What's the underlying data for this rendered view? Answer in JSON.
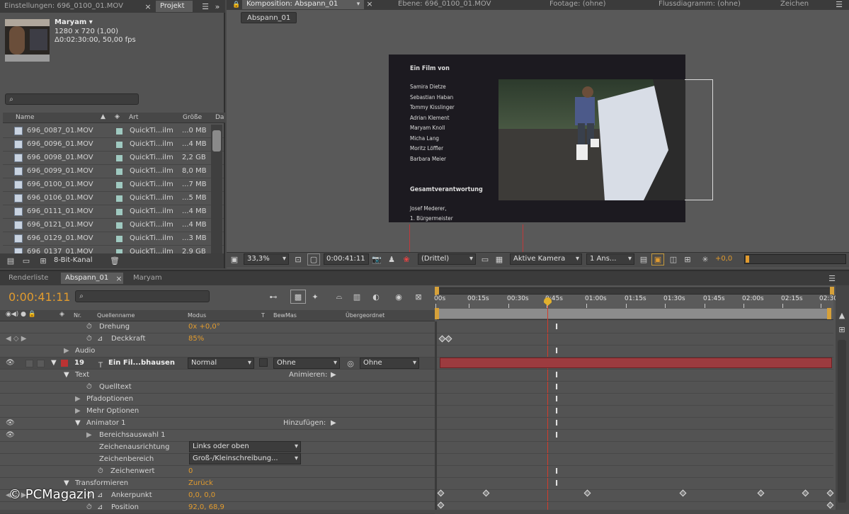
{
  "project_panel": {
    "tab_settings": "Einstellungen: 696_0100_01.MOV",
    "tab_project": "Projekt",
    "item_name": "Maryam",
    "item_dims": "1280 x 720 (1,00)",
    "item_duration": "Δ0:02:30:00, 50,00 fps",
    "search_placeholder": "",
    "col_name": "Name",
    "col_type": "Art",
    "col_size": "Größe",
    "col_extra": "Da",
    "rows": [
      {
        "name": "696_0087_01.MOV",
        "type": "QuickTi...ilm",
        "size": "...0 MB"
      },
      {
        "name": "696_0096_01.MOV",
        "type": "QuickTi...ilm",
        "size": "...4 MB"
      },
      {
        "name": "696_0098_01.MOV",
        "type": "QuickTi...ilm",
        "size": "2,2 GB"
      },
      {
        "name": "696_0099_01.MOV",
        "type": "QuickTi...ilm",
        "size": "8,0 MB"
      },
      {
        "name": "696_0100_01.MOV",
        "type": "QuickTi...ilm",
        "size": "...7 MB"
      },
      {
        "name": "696_0106_01.MOV",
        "type": "QuickTi...ilm",
        "size": "...5 MB"
      },
      {
        "name": "696_0111_01.MOV",
        "type": "QuickTi...ilm",
        "size": "...4 MB"
      },
      {
        "name": "696_0121_01.MOV",
        "type": "QuickTi...ilm",
        "size": "...4 MB"
      },
      {
        "name": "696_0129_01.MOV",
        "type": "QuickTi...ilm",
        "size": "...3 MB"
      },
      {
        "name": "696_0137_01.MOV",
        "type": "QuickTi...ilm",
        "size": "2,9 GB"
      }
    ],
    "bit_depth": "8-Bit-Kanal"
  },
  "viewer": {
    "tab_comp": "Komposition: Abspann_01",
    "tab_layer": "Ebene: 696_0100_01.MOV",
    "tab_footage": "Footage: (ohne)",
    "tab_flow": "Flussdiagramm: (ohne)",
    "tab_sign": "Zeichen",
    "comp_button": "Abspann_01",
    "zoom": "33,3%",
    "timecode": "0:00:41:11",
    "resolution": "(Drittel)",
    "camera": "Aktive Kamera",
    "views": "1 Ans...",
    "exposure": "+0,0"
  },
  "credits": {
    "heading": "Ein Film von",
    "names": [
      "Samira Dietze",
      "Sebastian Haban",
      "Tommy Kisslinger",
      "Adrian Klement",
      "Maryam Knoll",
      "Micha Lang",
      "Moritz Löffler",
      "Barbara Meier"
    ],
    "heading2": "Gesamtverantwortung",
    "line1": "Josef Mederer,",
    "line2": "1. Bürgermeister"
  },
  "timeline": {
    "tab_render": "Renderliste",
    "tab_abspann": "Abspann_01",
    "tab_maryam": "Maryam",
    "current_time": "0:00:41:11",
    "col_nr": "Nr.",
    "col_source": "Quellenname",
    "col_mode": "Modus",
    "col_t": "T",
    "col_trkmat": "BewMas",
    "col_parent": "Übergeordnet",
    "ticks": [
      "00s",
      "00:15s",
      "00:30s",
      "0:45s",
      "01:00s",
      "01:15s",
      "01:30s",
      "01:45s",
      "02:00s",
      "02:15s",
      "02:30"
    ],
    "rows": {
      "rotation_label": "Drehung",
      "rotation_value": "0x +0,0°",
      "opacity_label": "Deckkraft",
      "opacity_value": "85%",
      "audio_label": "Audio",
      "layer_nr": "19",
      "layer_name": "Ein Fil...bhausen",
      "layer_mode": "Normal",
      "layer_trkmat": "Ohne",
      "layer_parent": "Ohne",
      "text_label": "Text",
      "animate_label": "Animieren:",
      "source_text": "Quelltext",
      "path_options": "Pfadoptionen",
      "more_options": "Mehr Optionen",
      "animator": "Animator 1",
      "add_label": "Hinzufügen:",
      "range_selector": "Bereichsauswahl 1",
      "char_align_label": "Zeichenausrichtung",
      "char_align_value": "Links oder oben",
      "char_range_label": "Zeichenbereich",
      "char_range_value": "Groß-/Kleinschreibung...",
      "char_value_label": "Zeichenwert",
      "char_value": "0",
      "transform_label": "Transformieren",
      "transform_reset": "Zurück",
      "anchor_label": "Ankerpunkt",
      "anchor_value": "0,0, 0,0",
      "position_label": "Position",
      "position_value": "92,0, 68,9"
    }
  },
  "watermark": "© PCMagazin",
  "colors": {
    "accent": "#e19b2e",
    "playhead": "#d23c2c",
    "layer_bar": "#9c3b3f"
  }
}
